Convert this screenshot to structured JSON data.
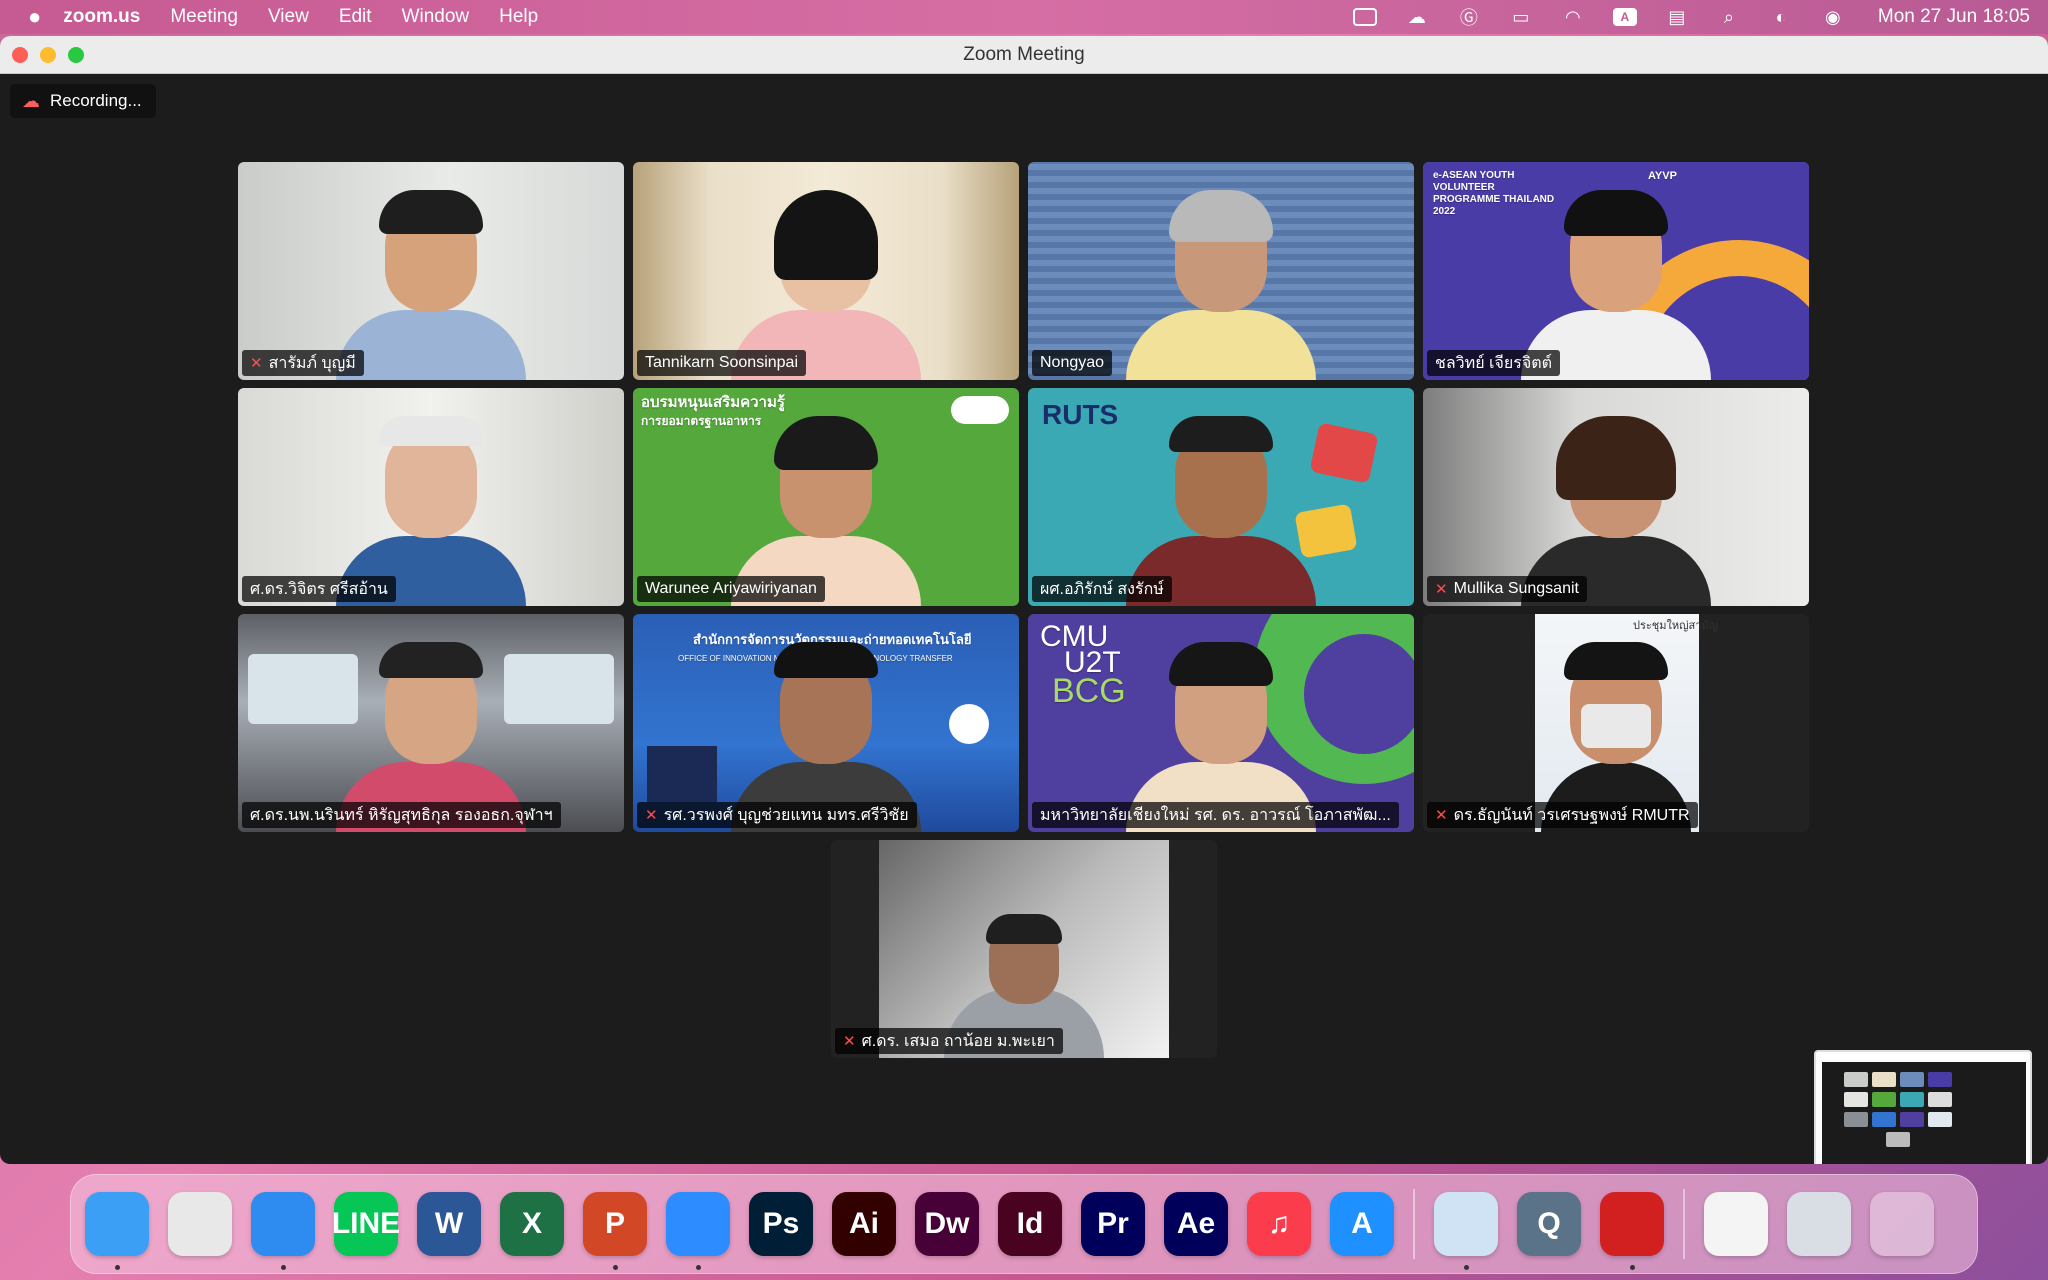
{
  "menubar": {
    "apple": "",
    "app_name": "zoom.us",
    "items": [
      "Meeting",
      "View",
      "Edit",
      "Window",
      "Help"
    ],
    "input_source": "A",
    "clock": "Mon 27 Jun  18:05"
  },
  "window": {
    "title": "Zoom Meeting",
    "recording_label": "Recording..."
  },
  "participants": [
    {
      "name": "สารัมภ์ บุญมี",
      "muted": true
    },
    {
      "name": "Tannikarn Soonsinpai",
      "muted": false
    },
    {
      "name": "Nongyao",
      "muted": false
    },
    {
      "name": "ชลวิทย์ เจียรจิตต์",
      "muted": false,
      "speaking": true
    },
    {
      "name": "ศ.ดร.วิจิตร ศรีสอ้าน",
      "muted": false
    },
    {
      "name": "Warunee Ariyawiriyanan",
      "muted": false
    },
    {
      "name": "ผศ.อภิรักษ์ สงรักษ์",
      "muted": false
    },
    {
      "name": "Mullika Sungsanit",
      "muted": true
    },
    {
      "name": "ศ.ดร.นพ.นรินทร์ หิรัญสุทธิกุล รองอธก.จุฬาฯ",
      "muted": false
    },
    {
      "name": "รศ.วรพงศ์ บุญช่วยแทน มทร.ศรีวิชัย",
      "muted": true
    },
    {
      "name": "มหาวิทยาลัยเชียงใหม่ รศ. ดร. อาวรณ์ โอภาสพัฒ...",
      "muted": false
    },
    {
      "name": "ดร.ธัญนันท์ วรเศรษฐพงษ์ RMUTR",
      "muted": true
    },
    {
      "name": "ศ.ดร. เสมอ ถาน้อย ม.พะเยา",
      "muted": true
    }
  ],
  "backgrounds": {
    "aseanyvp": "e-ASEAN YOUTH VOLUNTEER PROGRAMME THAILAND 2022",
    "aseanyvp_badge": "AYVP",
    "green_title": "อบรมหนุนเสริมความรู้",
    "green_sub": "การยอมาตรฐานอาหาร",
    "rmuts": "RUTS",
    "office_th": "สำนักการจัดการนวัตกรรมและถ่ายทอดเทคโนโลยี",
    "office_en": "OFFICE OF INNOVATION MANAGEMENT AND TECHNOLOGY TRANSFER",
    "cmu_line1": "CMU",
    "cmu_line2": "U2T",
    "cmu_line3": "BCG",
    "meeting_banner": "ประชุมใหญ่สามัญ"
  },
  "dock": [
    {
      "name": "finder-icon",
      "label": "",
      "bg": "#3ba0f5",
      "running": true
    },
    {
      "name": "launchpad-icon",
      "label": "",
      "bg": "#e8e8e8",
      "running": false
    },
    {
      "name": "safari-icon",
      "label": "",
      "bg": "#2e8cf0",
      "running": true
    },
    {
      "name": "line-icon",
      "label": "LINE",
      "bg": "#06c755",
      "running": false
    },
    {
      "name": "word-icon",
      "label": "W",
      "bg": "#2b5797",
      "running": false
    },
    {
      "name": "excel-icon",
      "label": "X",
      "bg": "#1e7145",
      "running": false
    },
    {
      "name": "powerpoint-icon",
      "label": "P",
      "bg": "#d24726",
      "running": true
    },
    {
      "name": "zoom-icon",
      "label": "",
      "bg": "#2d8cff",
      "running": true
    },
    {
      "name": "photoshop-icon",
      "label": "Ps",
      "bg": "#001e36",
      "running": false
    },
    {
      "name": "illustrator-icon",
      "label": "Ai",
      "bg": "#330000",
      "running": false
    },
    {
      "name": "dreamweaver-icon",
      "label": "Dw",
      "bg": "#470137",
      "running": false
    },
    {
      "name": "indesign-icon",
      "label": "Id",
      "bg": "#49021f",
      "running": false
    },
    {
      "name": "premiere-icon",
      "label": "Pr",
      "bg": "#00005b",
      "running": false
    },
    {
      "name": "after-effects-icon",
      "label": "Ae",
      "bg": "#00005b",
      "running": false
    },
    {
      "name": "music-icon",
      "label": "♫",
      "bg": "#fa3c4c",
      "running": false
    },
    {
      "name": "app-store-icon",
      "label": "A",
      "bg": "#1e90ff",
      "running": false
    },
    {
      "name": "preview-icon",
      "label": "",
      "bg": "#cfe3f5",
      "running": true
    },
    {
      "name": "quicktime-icon",
      "label": "Q",
      "bg": "#5a7388",
      "running": false
    },
    {
      "name": "acrobat-icon",
      "label": "",
      "bg": "#d21f1f",
      "running": true
    },
    {
      "name": "document-icon",
      "label": "",
      "bg": "#f4f4f4",
      "running": false
    },
    {
      "name": "screenshot-icon",
      "label": "",
      "bg": "#d9dde4",
      "running": false
    },
    {
      "name": "trash-icon",
      "label": "",
      "bg": "rgba(255,255,255,0.35)",
      "running": false
    }
  ]
}
